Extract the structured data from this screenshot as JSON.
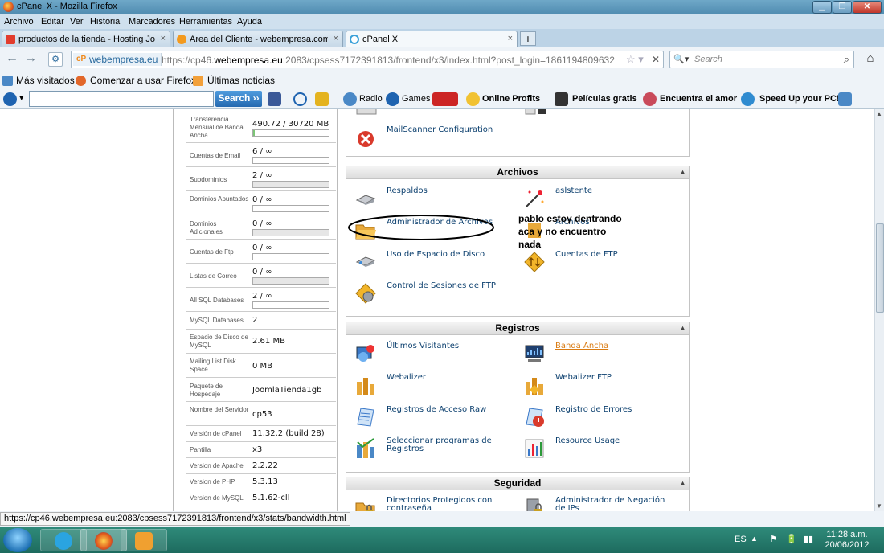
{
  "window": {
    "title": "cPanel X - Mozilla Firefox"
  },
  "menu": [
    "Archivo",
    "Editar",
    "Ver",
    "Historial",
    "Marcadores",
    "Herramientas",
    "Ayuda"
  ],
  "tabs": [
    {
      "label": "productos de la tienda - Hosting Joo...",
      "close": "×"
    },
    {
      "label": "Área del Cliente - webempresa.com",
      "close": "×"
    },
    {
      "label": "cPanel X",
      "close": "×"
    }
  ],
  "newtab": "+",
  "nav": {
    "site": "webempresa.eu",
    "url_prefix": "https://cp46.",
    "url_domain": "webempresa.eu",
    "url_rest": ":2083/cpsess7172391813/frontend/x3/index.html?post_login=1861194809632",
    "search_placeholder": "Search"
  },
  "bookmarks": [
    "Más visitados",
    "Comenzar a usar Firefox",
    "Últimas noticias"
  ],
  "toolbar": {
    "search_button": "Search",
    "items": [
      "Radio",
      "Games",
      "Online Profits",
      "Películas gratis",
      "Encuentra el amor",
      "Speed Up your PC!"
    ]
  },
  "stats": [
    {
      "label": "Transferencia Mensual de Banda Ancha",
      "value": "490.72 / 30720 MB",
      "bar": 0.016
    },
    {
      "label": "Cuentas de Email",
      "value": "6 / ∞",
      "bar": 0
    },
    {
      "label": "Subdominios",
      "value": "2 / ∞",
      "bar": 0
    },
    {
      "label": "Dominios Apuntados",
      "value": "0 / ∞",
      "bar": 0
    },
    {
      "label": "Dominios Adicionales",
      "value": "0 / ∞",
      "bar": 0
    },
    {
      "label": "Cuentas de Ftp",
      "value": "0 / ∞",
      "bar": 0
    },
    {
      "label": "Listas de Correo",
      "value": "0 / ∞",
      "bar": 0
    },
    {
      "label": "All SQL Databases",
      "value": "2 / ∞",
      "bar": 0
    },
    {
      "label": "MySQL Databases",
      "value": "2"
    },
    {
      "label": "Espacio de Disco de MySQL",
      "value": "2.61 MB"
    },
    {
      "label": "Mailing List Disk Space",
      "value": "0 MB"
    },
    {
      "label": "Paquete de Hospedaje",
      "value": "JoomlaTienda1gb"
    },
    {
      "label": "Nombre del Servidor",
      "value": "cp53"
    },
    {
      "label": "Versión de cPanel",
      "value": "11.32.2 (build 28)"
    },
    {
      "label": "Pantilla",
      "value": "x3"
    },
    {
      "label": "Version de Apache",
      "value": "2.2.22"
    },
    {
      "label": "Version de PHP",
      "value": "5.3.13"
    },
    {
      "label": "Version de MySQL",
      "value": "5.1.62-cll"
    }
  ],
  "top_item": "MailScanner Configuration",
  "panels": {
    "archivos": {
      "title": "Archivos",
      "items": [
        "Respaldos",
        "asÍstente",
        "Administrador de Archivos",
        "Archivos",
        "Uso de Espacio de Disco",
        "Cuentas de FTP",
        "Control de Sesiones de FTP"
      ]
    },
    "registros": {
      "title": "Registros",
      "items": [
        "Últimos Visitantes",
        "Banda Ancha",
        "Webalizer",
        "Webalizer FTP",
        "Registros de Acceso Raw",
        "Registro de Errores",
        "Seleccionar programas de Registros",
        "Resource Usage"
      ]
    },
    "seguridad": {
      "title": "Seguridad",
      "items": [
        "Directorios Protegidos con contraseña",
        "Administrador de Negación de IPs"
      ]
    }
  },
  "annotation": "pablo estoy dentrando aca y no encuentro nada",
  "status_url": "https://cp46.webempresa.eu:2083/cpsess7172391813/frontend/x3/stats/bandwidth.html",
  "taskbar": {
    "lang": "ES",
    "time": "11:28 a.m.",
    "date": "20/06/2012"
  },
  "colors": {
    "link": "#0b3f6e",
    "accent": "#d97b12",
    "search_button": "#2569b0",
    "taskbar": "#1d6b5e"
  }
}
